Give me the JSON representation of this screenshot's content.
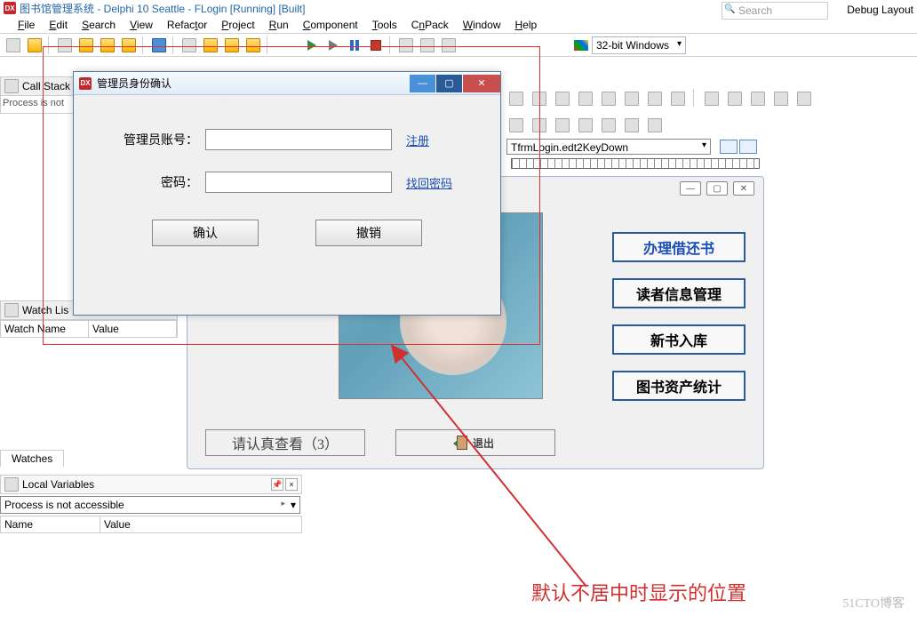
{
  "app": {
    "icon_text": "DX",
    "title": "图书馆管理系统 - Delphi 10 Seattle - FLogin [Running] [Built]"
  },
  "menu": {
    "items": [
      "File",
      "Edit",
      "Search",
      "View",
      "Refactor",
      "Project",
      "Run",
      "Component",
      "Tools",
      "CnPack",
      "Window",
      "Help"
    ]
  },
  "toolbar": {
    "platform_label": "32-bit Windows",
    "search_placeholder": "Search",
    "debug_layout": "Debug Layout"
  },
  "event_combo": "TfrmLogin.edt2KeyDown",
  "left": {
    "call_stack_title": "Call Stack",
    "process_not": "Process is not",
    "watch_list_title": "Watch Lis",
    "watch_cols": {
      "name": "Watch Name",
      "value": "Value"
    },
    "watches_tab": "Watches",
    "local_vars_title": "Local Variables",
    "process_not_accessible": "Process is not accessible",
    "lv_cols": {
      "name": "Name",
      "value": "Value"
    }
  },
  "login": {
    "title": "管理员身份确认",
    "acct_label": "管理员账号：",
    "pwd_label": "密码：",
    "register": "注册",
    "forgot": "找回密码",
    "ok": "确认",
    "cancel": "撤销"
  },
  "main": {
    "btn_borrow": "办理借还书",
    "btn_reader": "读者信息管理",
    "btn_newbook": "新书入库",
    "btn_assets": "图书资产统计",
    "btn_check": "请认真查看（3）",
    "btn_exit": "退出"
  },
  "annotation": "默认不居中时显示的位置",
  "watermark": "51CTO博客"
}
